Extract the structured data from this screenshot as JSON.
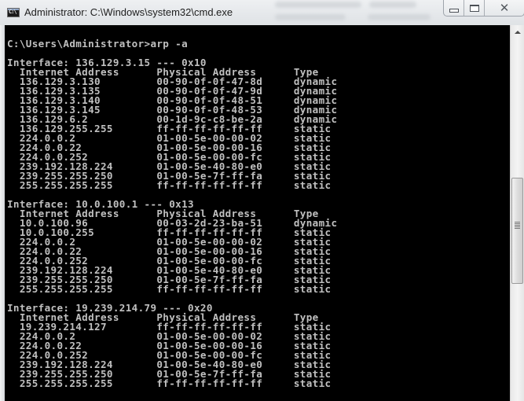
{
  "window": {
    "title": "Administrator: C:\\Windows\\system32\\cmd.exe",
    "icon": "cmd-icon",
    "icon_text": "C:\\",
    "controls": {
      "minimize": "minimize-icon",
      "maximize": "maximize-icon",
      "close": "close-icon",
      "close_glyph": "✕"
    }
  },
  "console": {
    "prompt": "C:\\Users\\Administrator>arp -a",
    "column_headers": {
      "internet_address": "Internet Address",
      "physical_address": "Physical Address",
      "type": "Type"
    },
    "interfaces": [
      {
        "header": "Interface: 136.129.3.15 --- 0x10",
        "entries": [
          {
            "ip": "136.129.3.130",
            "mac": "00-90-0f-0f-47-8d",
            "type": "dynamic"
          },
          {
            "ip": "136.129.3.135",
            "mac": "00-90-0f-0f-47-9d",
            "type": "dynamic"
          },
          {
            "ip": "136.129.3.140",
            "mac": "00-90-0f-0f-48-51",
            "type": "dynamic"
          },
          {
            "ip": "136.129.3.145",
            "mac": "00-90-0f-0f-48-53",
            "type": "dynamic"
          },
          {
            "ip": "136.129.6.2",
            "mac": "00-1d-9c-c8-be-2a",
            "type": "dynamic"
          },
          {
            "ip": "136.129.255.255",
            "mac": "ff-ff-ff-ff-ff-ff",
            "type": "static"
          },
          {
            "ip": "224.0.0.2",
            "mac": "01-00-5e-00-00-02",
            "type": "static"
          },
          {
            "ip": "224.0.0.22",
            "mac": "01-00-5e-00-00-16",
            "type": "static"
          },
          {
            "ip": "224.0.0.252",
            "mac": "01-00-5e-00-00-fc",
            "type": "static"
          },
          {
            "ip": "239.192.128.224",
            "mac": "01-00-5e-40-80-e0",
            "type": "static"
          },
          {
            "ip": "239.255.255.250",
            "mac": "01-00-5e-7f-ff-fa",
            "type": "static"
          },
          {
            "ip": "255.255.255.255",
            "mac": "ff-ff-ff-ff-ff-ff",
            "type": "static"
          }
        ]
      },
      {
        "header": "Interface: 10.0.100.1 --- 0x13",
        "entries": [
          {
            "ip": "10.0.100.96",
            "mac": "00-03-2d-23-ba-51",
            "type": "dynamic"
          },
          {
            "ip": "10.0.100.255",
            "mac": "ff-ff-ff-ff-ff-ff",
            "type": "static"
          },
          {
            "ip": "224.0.0.2",
            "mac": "01-00-5e-00-00-02",
            "type": "static"
          },
          {
            "ip": "224.0.0.22",
            "mac": "01-00-5e-00-00-16",
            "type": "static"
          },
          {
            "ip": "224.0.0.252",
            "mac": "01-00-5e-00-00-fc",
            "type": "static"
          },
          {
            "ip": "239.192.128.224",
            "mac": "01-00-5e-40-80-e0",
            "type": "static"
          },
          {
            "ip": "239.255.255.250",
            "mac": "01-00-5e-7f-ff-fa",
            "type": "static"
          },
          {
            "ip": "255.255.255.255",
            "mac": "ff-ff-ff-ff-ff-ff",
            "type": "static"
          }
        ]
      },
      {
        "header": "Interface: 19.239.214.79 --- 0x20",
        "entries": [
          {
            "ip": "19.239.214.127",
            "mac": "ff-ff-ff-ff-ff-ff",
            "type": "static"
          },
          {
            "ip": "224.0.0.2",
            "mac": "01-00-5e-00-00-02",
            "type": "static"
          },
          {
            "ip": "224.0.0.22",
            "mac": "01-00-5e-00-00-16",
            "type": "static"
          },
          {
            "ip": "224.0.0.252",
            "mac": "01-00-5e-00-00-fc",
            "type": "static"
          },
          {
            "ip": "239.192.128.224",
            "mac": "01-00-5e-40-80-e0",
            "type": "static"
          },
          {
            "ip": "239.255.255.250",
            "mac": "01-00-5e-7f-ff-fa",
            "type": "static"
          },
          {
            "ip": "255.255.255.255",
            "mac": "ff-ff-ff-ff-ff-ff",
            "type": "static"
          }
        ]
      }
    ]
  },
  "scrollbar": {
    "up_icon": "scroll-up-arrow-icon",
    "thumb_icon": "scroll-grip-icon",
    "position_fraction": 0.45
  },
  "colors": {
    "console_bg": "#000000",
    "console_fg": "#c0c0c0",
    "title_text": "#1e1e1e"
  }
}
